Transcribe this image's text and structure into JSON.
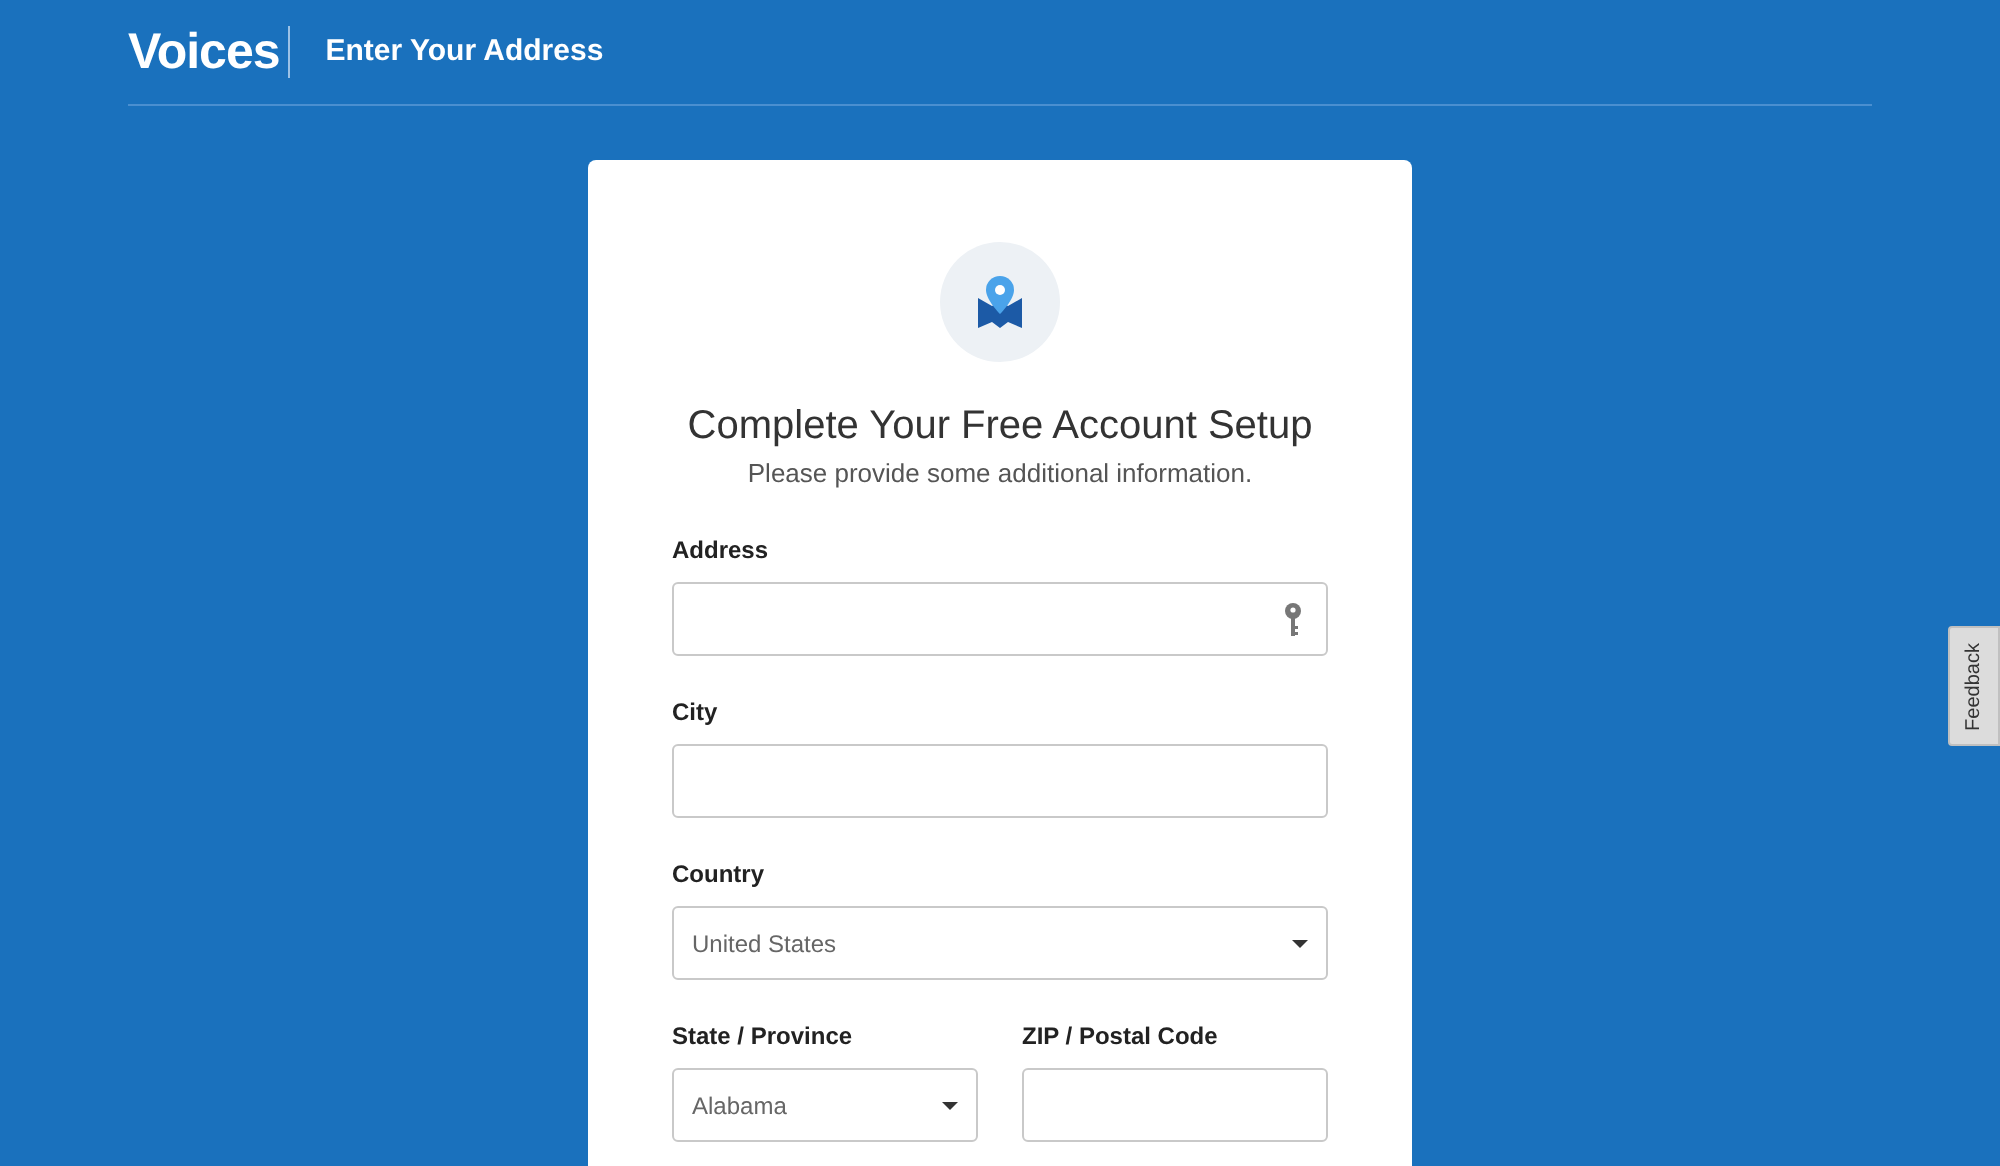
{
  "header": {
    "logo": "Voices",
    "page_title": "Enter Your Address"
  },
  "card": {
    "title": "Complete Your Free Account Setup",
    "subtitle": "Please provide some additional information.",
    "rows": [
      [
        {
          "kind": "text",
          "label": "Address",
          "autofill_key": true
        }
      ],
      [
        {
          "kind": "text",
          "label": "City"
        }
      ],
      [
        {
          "kind": "select",
          "label": "Country",
          "value": "United States"
        }
      ],
      [
        {
          "kind": "select",
          "label": "State / Province",
          "value": "Alabama"
        },
        {
          "kind": "text",
          "label": "ZIP / Postal Code"
        }
      ]
    ]
  },
  "feedback_tab": {
    "label": "Feedback"
  }
}
